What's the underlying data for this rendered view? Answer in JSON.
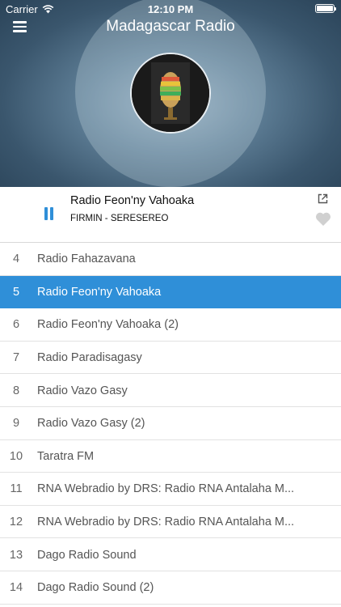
{
  "status_bar": {
    "carrier": "Carrier",
    "time": "12:10 PM"
  },
  "header": {
    "title": "Madagascar Radio"
  },
  "player": {
    "station": "Radio Feon'ny Vahoaka",
    "track": "FIRMIN - SERESEREO",
    "is_playing": true
  },
  "stations": [
    {
      "num": "4",
      "name": "Radio Fahazavana"
    },
    {
      "num": "5",
      "name": "Radio Feon'ny Vahoaka"
    },
    {
      "num": "6",
      "name": "Radio Feon'ny Vahoaka (2)"
    },
    {
      "num": "7",
      "name": "Radio Paradisagasy"
    },
    {
      "num": "8",
      "name": "Radio Vazo Gasy"
    },
    {
      "num": "9",
      "name": "Radio Vazo Gasy (2)"
    },
    {
      "num": "10",
      "name": "Taratra FM"
    },
    {
      "num": "11",
      "name": "RNA Webradio by DRS: Radio RNA Antalaha M..."
    },
    {
      "num": "12",
      "name": "RNA Webradio by DRS: Radio RNA Antalaha M..."
    },
    {
      "num": "13",
      "name": "Dago Radio Sound"
    },
    {
      "num": "14",
      "name": "Dago Radio Sound (2)"
    }
  ],
  "active_station_index": 1,
  "colors": {
    "accent": "#2f8fd8",
    "header_bg": "#3a566d",
    "heart": "#d0d0d0"
  },
  "icons": {
    "menu": "hamburger-menu-icon",
    "wifi": "wifi-icon",
    "battery": "battery-icon",
    "pause": "pause-icon",
    "share": "share-icon",
    "favorite": "heart-icon",
    "logo": "microphone-logo"
  }
}
